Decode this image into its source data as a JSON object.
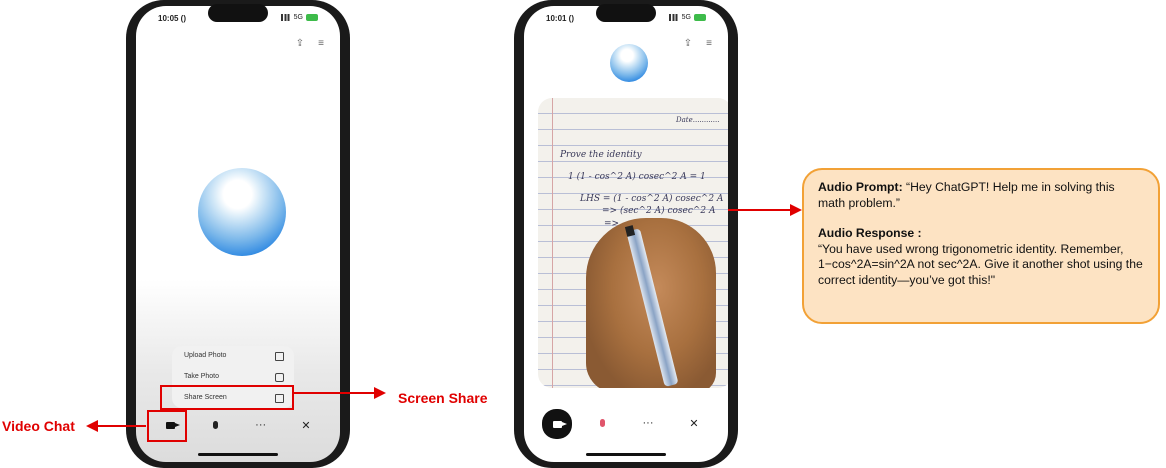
{
  "phone1": {
    "status_time": "10:05 ()",
    "status_network": "5G",
    "menu": [
      "Upload Photo",
      "Take Photo",
      "Share Screen"
    ],
    "toolbar": [
      "video",
      "mic",
      "more",
      "close"
    ]
  },
  "phone2": {
    "status_time": "10:01 ()",
    "status_network": "5G",
    "notebook": {
      "date": "Date............",
      "lines": [
        "Prove the identity",
        "1 (1 - cos^2 A) cosec^2 A = 1",
        "LHS = (1 - cos^2 A) cosec^2 A",
        "=> (sec^2 A) cosec^2 A",
        "=>"
      ]
    }
  },
  "labels": {
    "video_chat": "Video Chat",
    "screen_share": "Screen Share"
  },
  "glyphs": {
    "more": "···",
    "close": "✕"
  },
  "callout": {
    "prompt_title": "Audio Prompt:",
    "prompt_text": "“Hey ChatGPT! Help me in solving this math problem.”",
    "response_title": "Audio Response :",
    "response_text_1": "“You have used wrong trigonometric identity. Remember,",
    "response_text_2": "1−cos^2A=sin^2A not sec^2A. Give it another shot using the correct identity—you’ve got this!\""
  },
  "colors": {
    "annotation_red": "#e00000",
    "callout_fill": "#fde3c3",
    "callout_border": "#f2a136"
  }
}
